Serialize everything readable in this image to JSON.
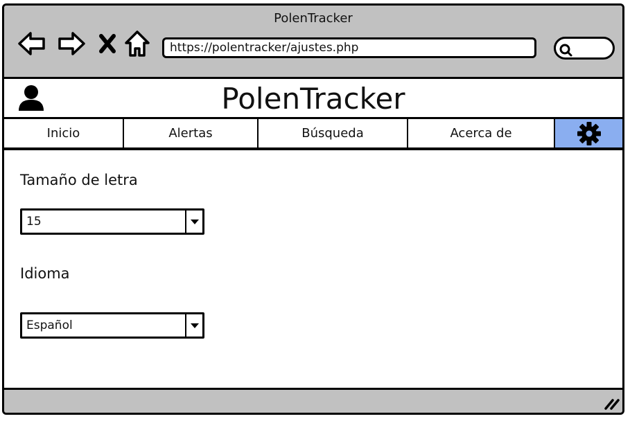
{
  "window": {
    "title": "PolenTracker"
  },
  "browser": {
    "url": "https://polentracker/ajustes.php",
    "icons": [
      "back-arrow-icon",
      "forward-arrow-icon",
      "close-icon",
      "home-icon",
      "search-icon"
    ]
  },
  "app": {
    "title": "PolenTracker",
    "avatar_icon": "user-icon"
  },
  "tabs": [
    {
      "label": "Inicio"
    },
    {
      "label": "Alertas"
    },
    {
      "label": "Búsqueda"
    },
    {
      "label": "Acerca de"
    }
  ],
  "settings_tab": {
    "icon": "gear-icon",
    "active": true,
    "color": "#8aaef0"
  },
  "settings": {
    "font_size": {
      "label": "Tamaño de letra",
      "value": "15"
    },
    "language": {
      "label": "Idioma",
      "value": "Español"
    }
  },
  "colors": {
    "chrome": "#c1c1c1",
    "active_tab": "#8aaef0"
  }
}
